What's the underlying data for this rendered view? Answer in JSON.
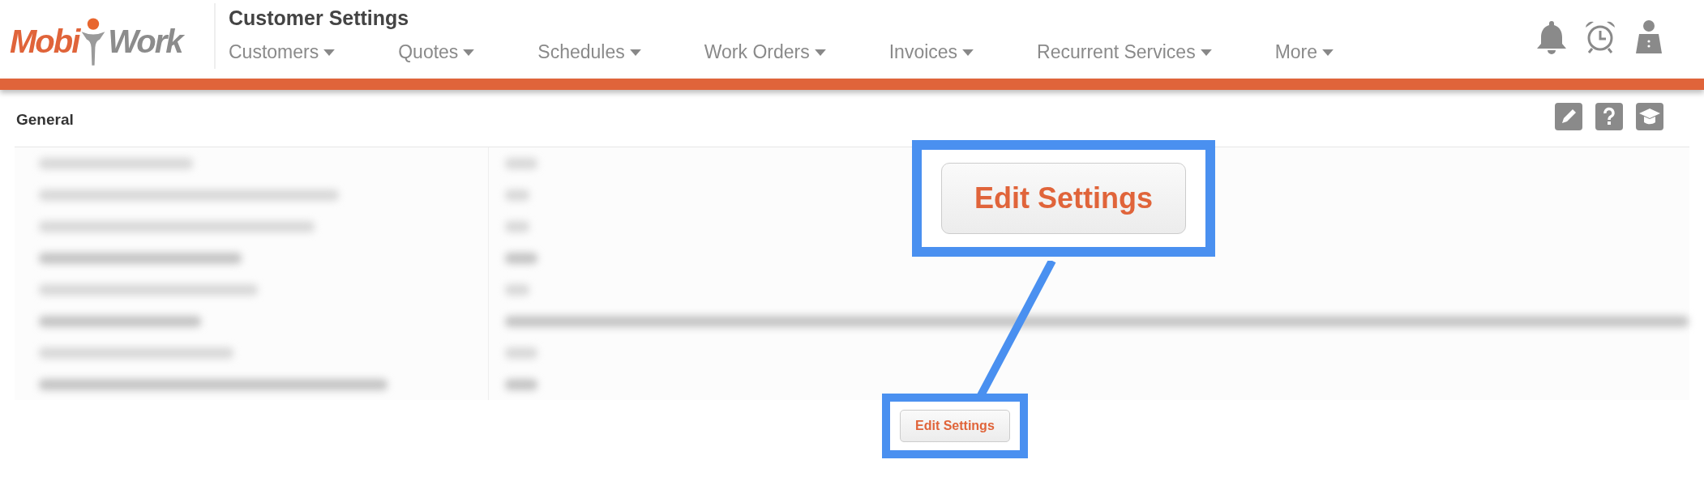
{
  "header": {
    "logo": {
      "left": "Mobi",
      "right": "Work"
    },
    "title": "Customer Settings",
    "nav": [
      {
        "label": "Customers",
        "dropdown": true
      },
      {
        "label": "Quotes",
        "dropdown": true
      },
      {
        "label": "Schedules",
        "dropdown": true
      },
      {
        "label": "Work Orders",
        "dropdown": true
      },
      {
        "label": "Invoices",
        "dropdown": true
      },
      {
        "label": "Recurrent Services",
        "dropdown": true
      },
      {
        "label": "More",
        "dropdown": true
      }
    ]
  },
  "section": {
    "title": "General"
  },
  "edit_button": {
    "label": "Edit Settings"
  },
  "callout": {
    "label": "Edit Settings"
  }
}
